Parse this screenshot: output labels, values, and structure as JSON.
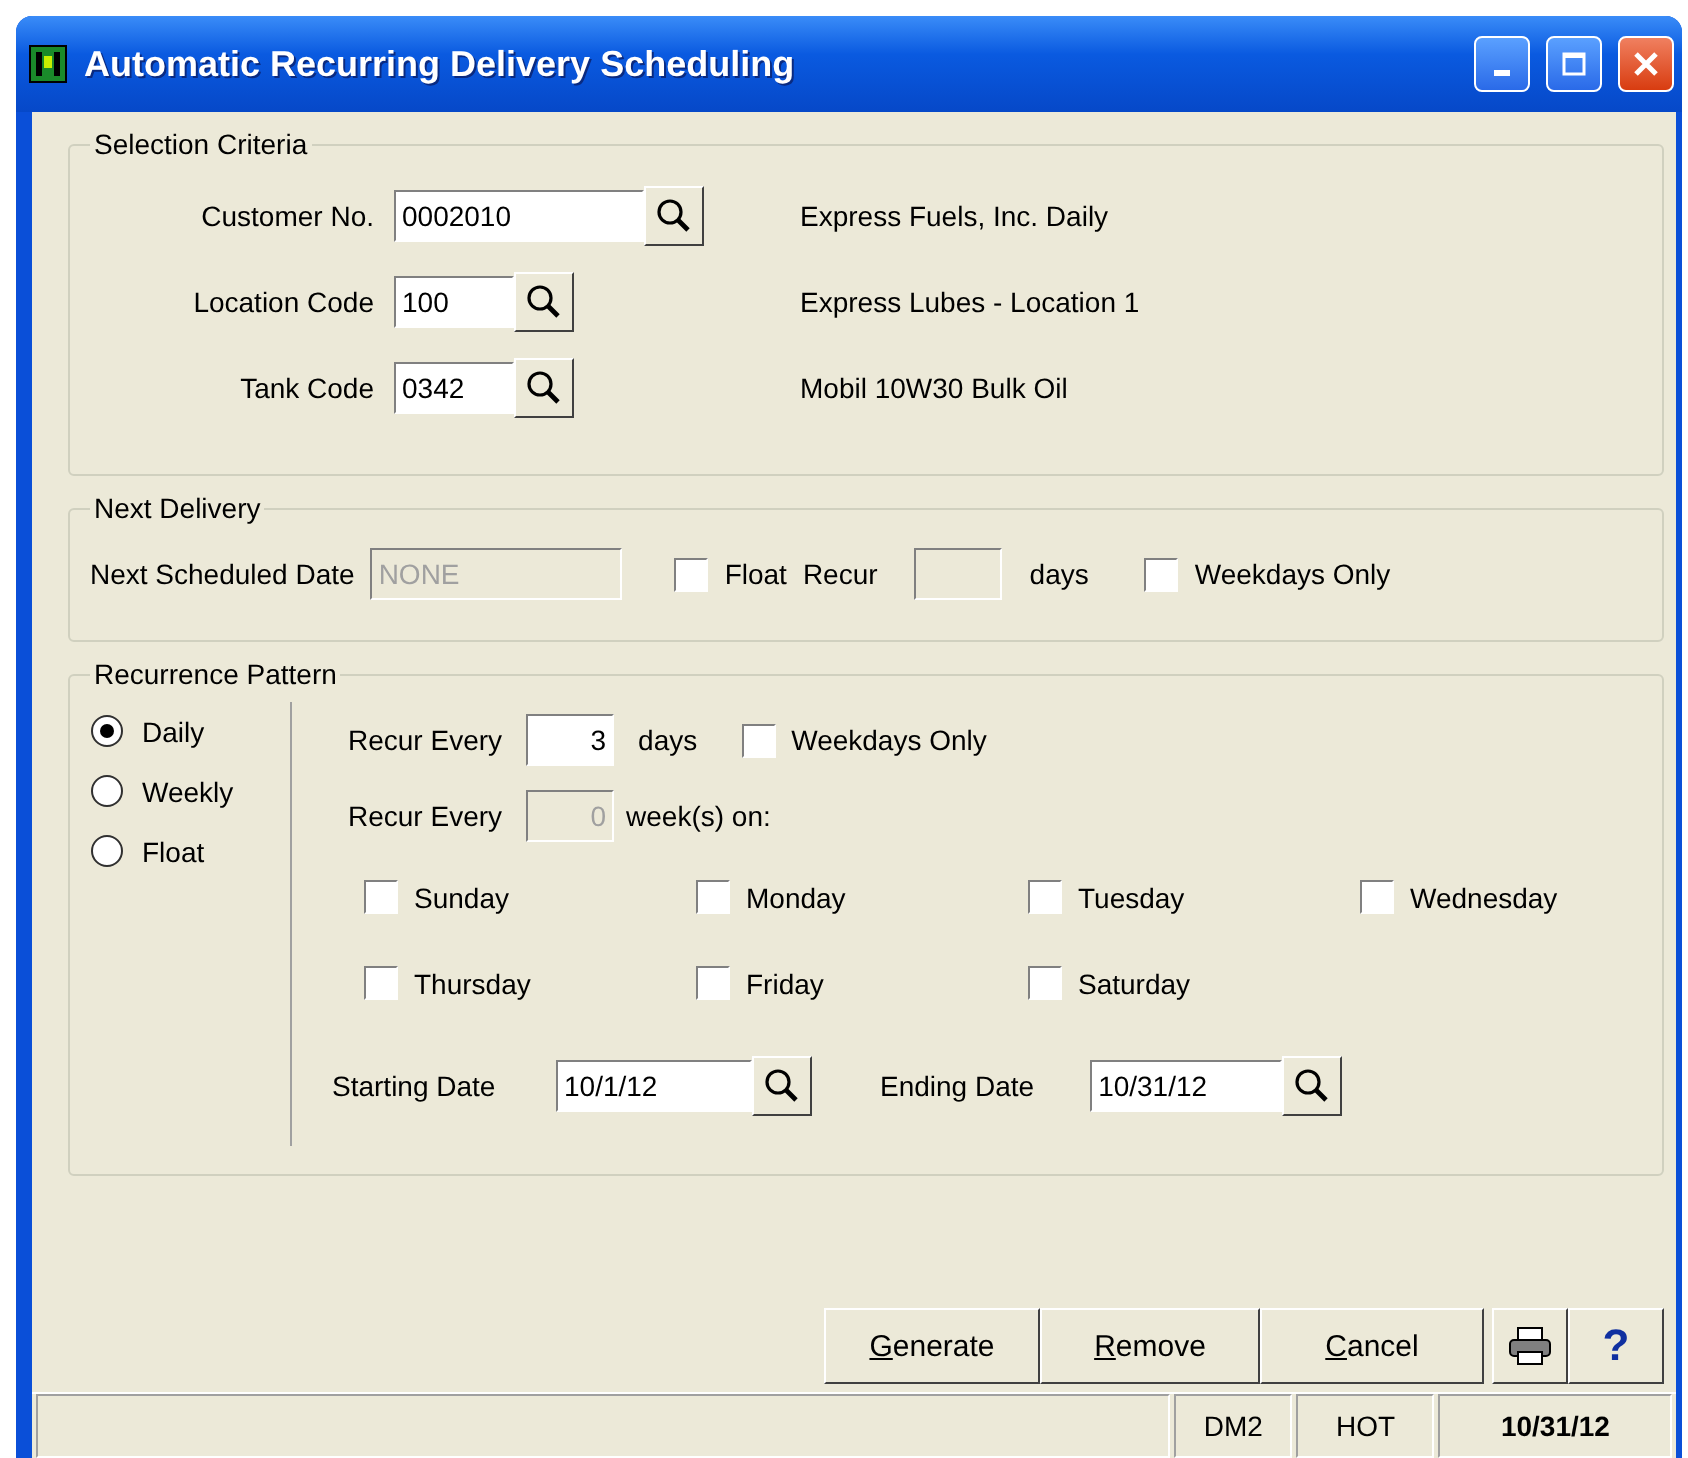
{
  "window": {
    "title": "Automatic Recurring Delivery Scheduling"
  },
  "selection_criteria": {
    "title": "Selection Criteria",
    "fields": [
      {
        "label": "Customer No.",
        "value": "0002010",
        "description": "Express Fuels, Inc. Daily"
      },
      {
        "label": "Location Code",
        "value": "100",
        "description": "Express Lubes - Location 1"
      },
      {
        "label": "Tank Code",
        "value": "0342",
        "description": "Mobil 10W30 Bulk Oil"
      }
    ]
  },
  "next_delivery": {
    "title": "Next Delivery",
    "date_label": "Next Scheduled Date",
    "date_value": "NONE",
    "float": {
      "label": "Float",
      "checked": false
    },
    "recur_label": "Recur",
    "days_label": "days",
    "weekdays_only": {
      "label": "Weekdays Only",
      "checked": false
    }
  },
  "recurrence_pattern": {
    "title": "Recurrence Pattern",
    "options": [
      {
        "label": "Daily",
        "selected": true
      },
      {
        "label": "Weekly",
        "selected": false
      },
      {
        "label": "Float",
        "selected": false
      }
    ],
    "daily": {
      "label": "Recur Every",
      "value": "3",
      "unit": "days",
      "disabled": false,
      "weekdays_only": {
        "label": "Weekdays Only",
        "checked": false
      }
    },
    "weekly": {
      "label": "Recur Every",
      "value": "0",
      "unit": "week(s) on:",
      "disabled": true
    },
    "days": [
      {
        "label": "Sunday",
        "checked": false
      },
      {
        "label": "Monday",
        "checked": false
      },
      {
        "label": "Tuesday",
        "checked": false
      },
      {
        "label": "Wednesday",
        "checked": false
      },
      {
        "label": "Thursday",
        "checked": false
      },
      {
        "label": "Friday",
        "checked": false
      },
      {
        "label": "Saturday",
        "checked": false
      }
    ],
    "starting_date": {
      "label": "Starting Date",
      "value": "10/1/12"
    },
    "ending_date": {
      "label": "Ending Date",
      "value": "10/31/12"
    }
  },
  "buttons": [
    {
      "label": "Generate"
    },
    {
      "label": "Remove"
    },
    {
      "label": "Cancel"
    }
  ],
  "help_button": {
    "label": "?"
  },
  "status_bar": {
    "panels": [
      "DM2",
      "HOT",
      "10/31/12"
    ]
  }
}
